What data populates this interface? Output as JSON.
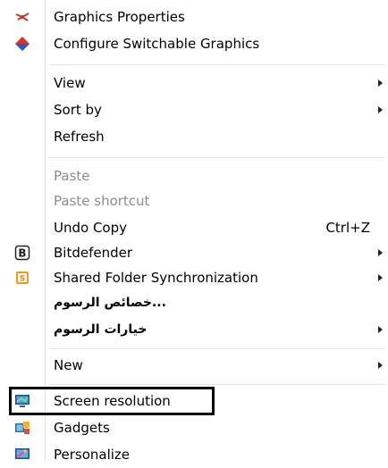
{
  "menu": {
    "items": [
      {
        "label": "Graphics Properties",
        "icon": "graphics-properties-icon"
      },
      {
        "label": "Configure Switchable Graphics",
        "icon": "switchable-graphics-icon"
      },
      {
        "label": "View",
        "submenu": true
      },
      {
        "label": "Sort by",
        "submenu": true
      },
      {
        "label": "Refresh"
      },
      {
        "label": "Paste",
        "disabled": true
      },
      {
        "label": "Paste shortcut",
        "disabled": true
      },
      {
        "label": "Undo Copy",
        "shortcut": "Ctrl+Z"
      },
      {
        "label": "Bitdefender",
        "submenu": true,
        "icon": "bitdefender-icon"
      },
      {
        "label": "Shared Folder Synchronization",
        "submenu": true,
        "icon": "sync-icon"
      },
      {
        "label": "...خصائص الرسوم"
      },
      {
        "label": "خيارات الرسوم",
        "submenu": true
      },
      {
        "label": "New",
        "submenu": true
      },
      {
        "label": "Screen resolution",
        "icon": "screen-resolution-icon",
        "highlighted": true
      },
      {
        "label": "Gadgets",
        "icon": "gadgets-icon"
      },
      {
        "label": "Personalize",
        "icon": "personalize-icon"
      }
    ]
  }
}
